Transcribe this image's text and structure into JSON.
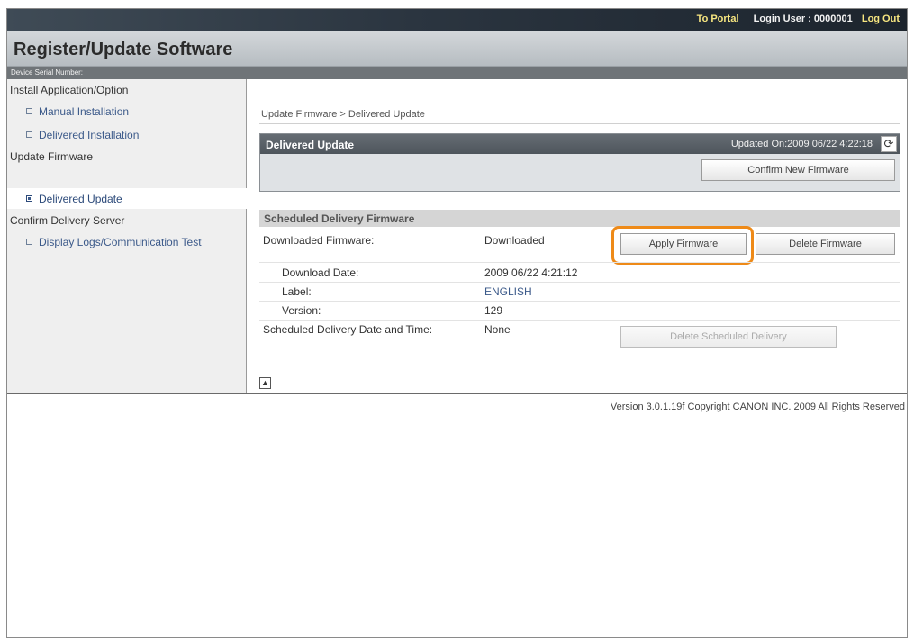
{
  "header": {
    "portal_link": "To Portal",
    "login_label": "Login User : 0000001",
    "logout_link": "Log Out"
  },
  "page_title": "Register/Update Software",
  "device_serial_label": "Device Serial Number:",
  "sidebar": {
    "sections": [
      {
        "title": "Install Application/Option",
        "items": [
          "Manual Installation",
          "Delivered Installation"
        ]
      },
      {
        "title": "Update Firmware",
        "items": [
          "Delivered Update"
        ]
      },
      {
        "title": "Confirm Delivery Server",
        "items": [
          "Display Logs/Communication Test"
        ]
      }
    ],
    "active_item": "Delivered Update"
  },
  "breadcrumb": "Update Firmware > Delivered Update",
  "panel": {
    "title": "Delivered Update",
    "updated_on": "Updated On:2009 06/22 4:22:18",
    "confirm_button": "Confirm New Firmware"
  },
  "scheduled": {
    "section_title": "Scheduled Delivery Firmware",
    "downloaded_label": "Downloaded Firmware:",
    "downloaded_value": "Downloaded",
    "apply_button": "Apply Firmware",
    "delete_button": "Delete Firmware",
    "download_date_label": "Download Date:",
    "download_date_value": "2009 06/22 4:21:12",
    "label_label": "Label:",
    "label_value": "ENGLISH",
    "version_label": "Version:",
    "version_value": "129",
    "schedule_label": "Scheduled Delivery Date and Time:",
    "schedule_value": "None",
    "delete_schedule_button": "Delete Scheduled Delivery"
  },
  "back_to_top_icon": "▲",
  "footer": "Version 3.0.1.19f Copyright CANON INC. 2009 All Rights Reserved",
  "colors": {
    "accent_highlight": "#ee8a18",
    "link": "#3c5a8a",
    "header_dark": "#2b3540"
  }
}
